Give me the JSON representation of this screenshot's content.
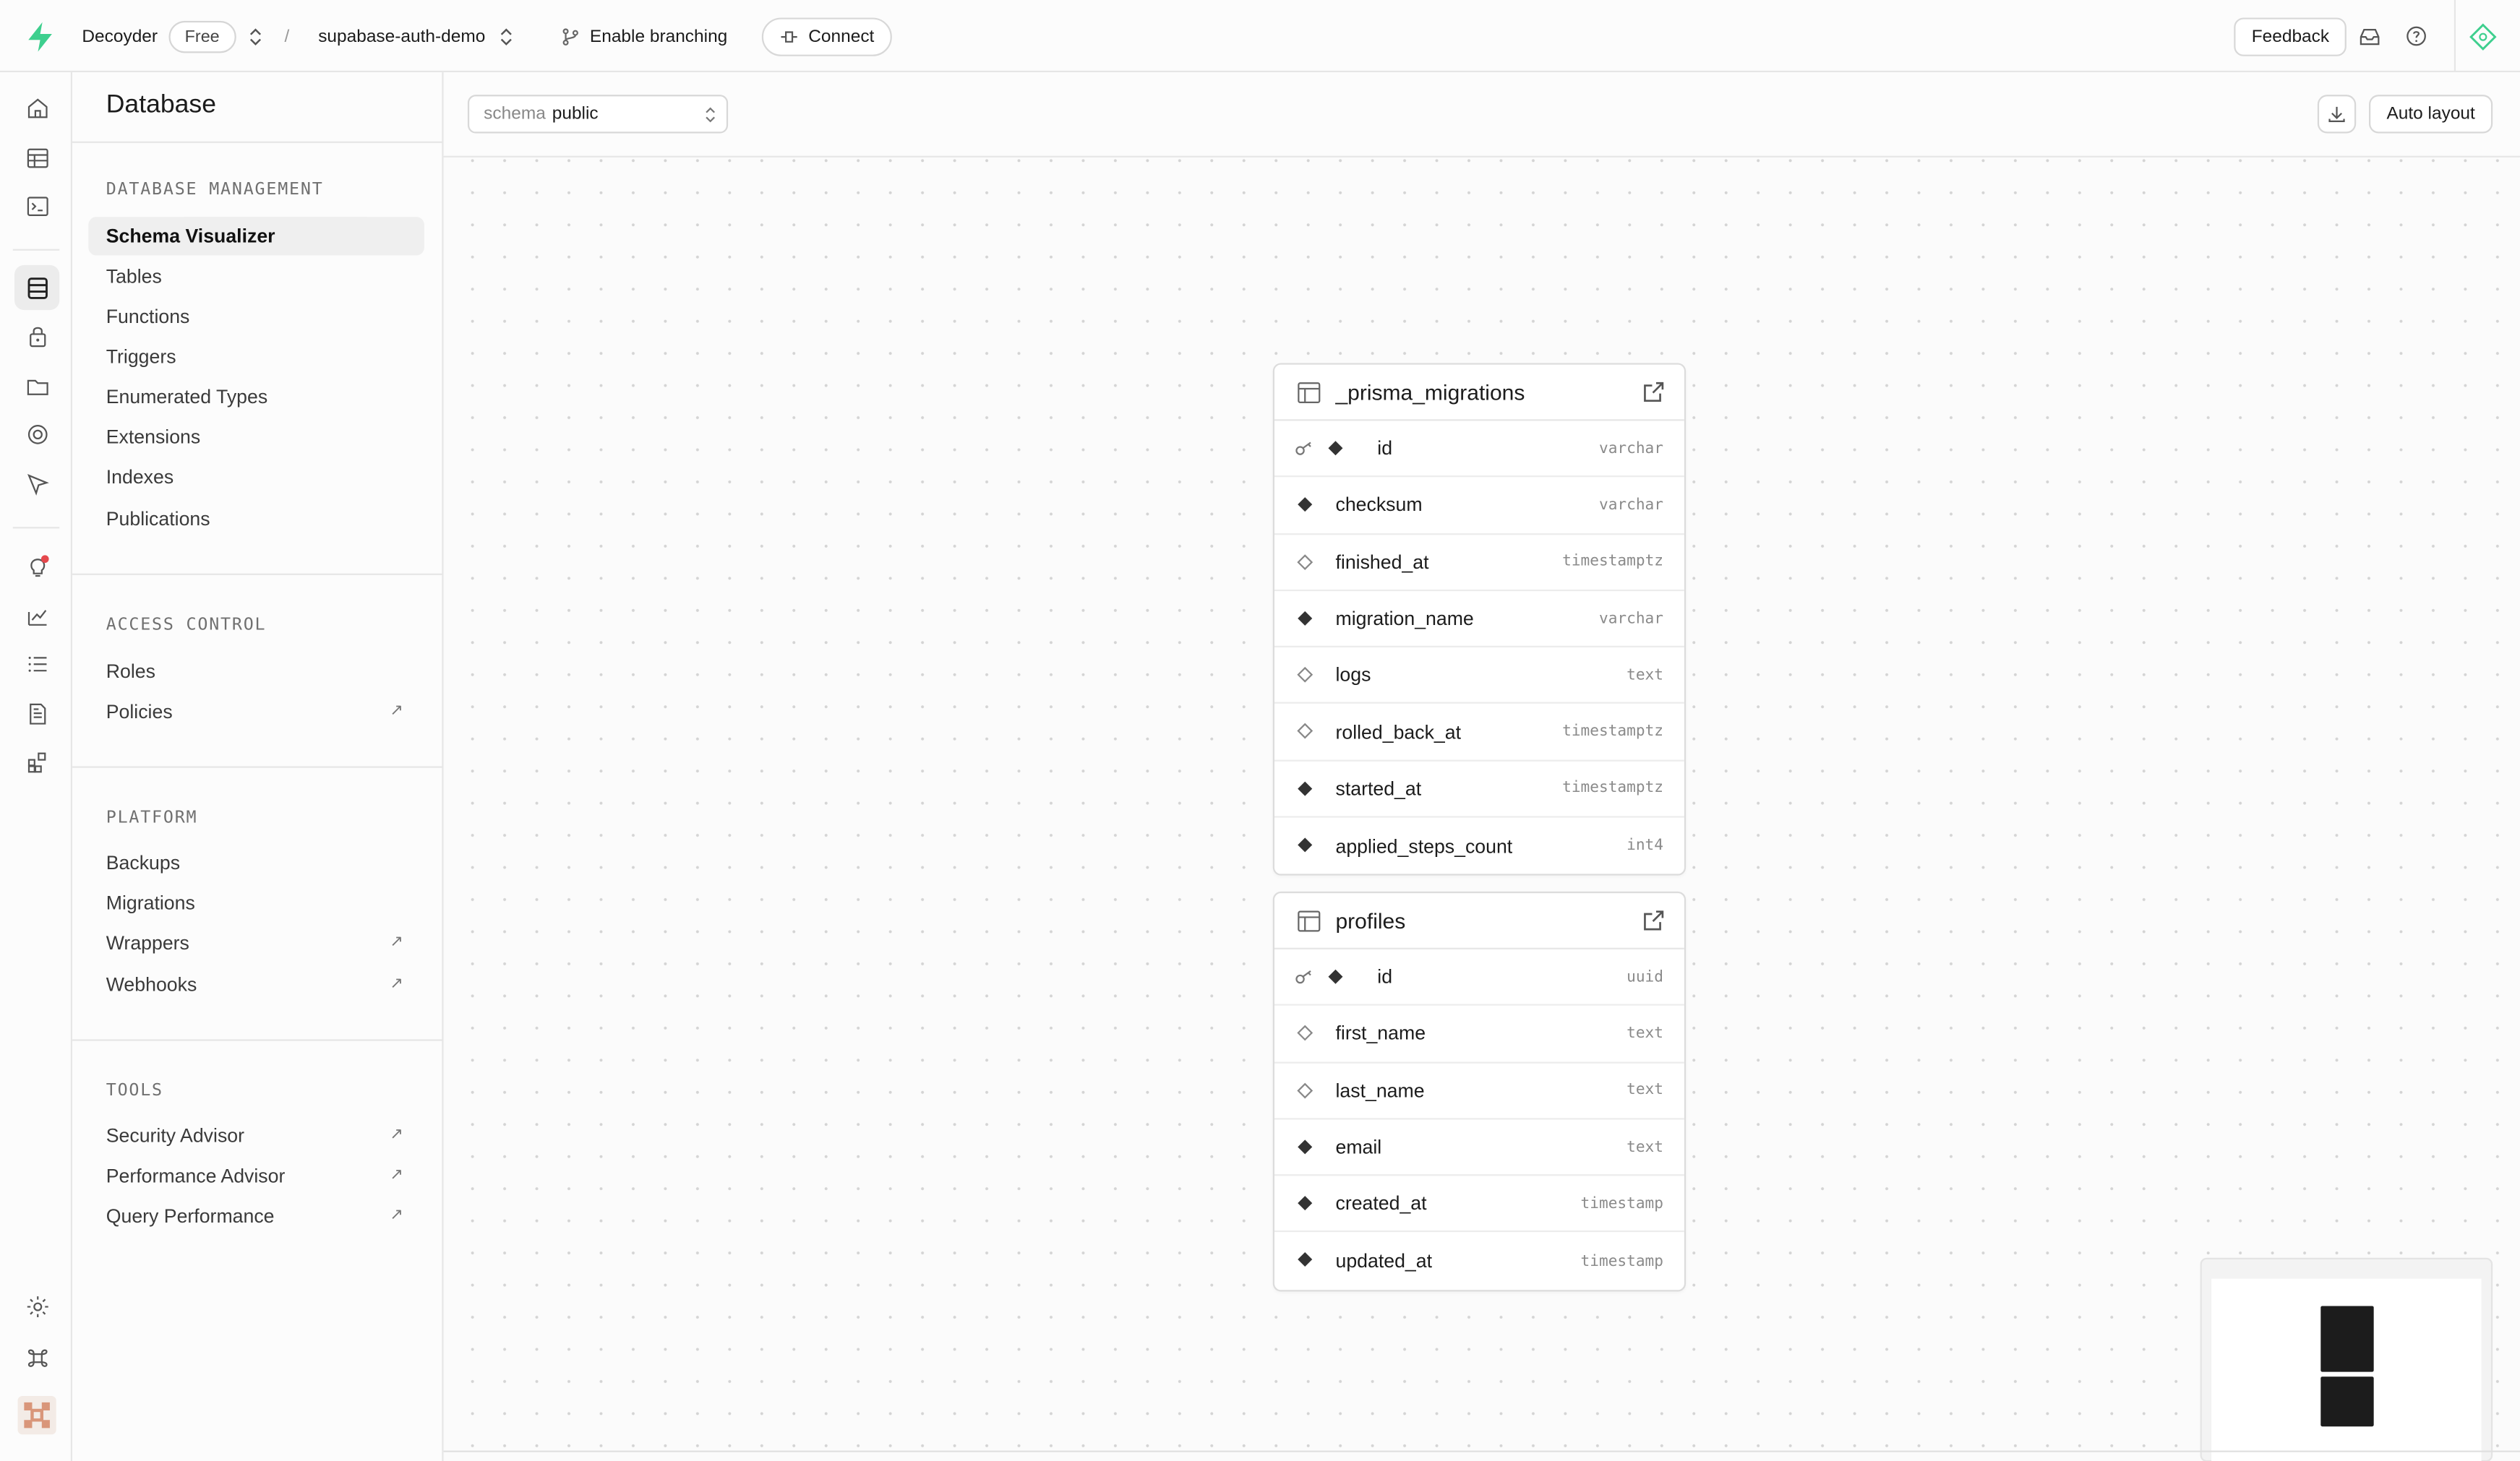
{
  "topbar": {
    "org_name": "Decoyder",
    "plan_badge": "Free",
    "separator": "/",
    "project_name": "supabase-auth-demo",
    "branching_label": "Enable branching",
    "connect_label": "Connect",
    "feedback_label": "Feedback"
  },
  "sidebar": {
    "title": "Database",
    "sections": [
      {
        "title": "DATABASE MANAGEMENT",
        "items": [
          {
            "label": "Schema Visualizer",
            "active": true
          },
          {
            "label": "Tables"
          },
          {
            "label": "Functions"
          },
          {
            "label": "Triggers"
          },
          {
            "label": "Enumerated Types"
          },
          {
            "label": "Extensions"
          },
          {
            "label": "Indexes"
          },
          {
            "label": "Publications"
          }
        ]
      },
      {
        "title": "ACCESS CONTROL",
        "items": [
          {
            "label": "Roles"
          },
          {
            "label": "Policies",
            "external": true
          }
        ]
      },
      {
        "title": "PLATFORM",
        "items": [
          {
            "label": "Backups"
          },
          {
            "label": "Migrations"
          },
          {
            "label": "Wrappers",
            "external": true
          },
          {
            "label": "Webhooks",
            "external": true
          }
        ]
      },
      {
        "title": "TOOLS",
        "items": [
          {
            "label": "Security Advisor",
            "external": true
          },
          {
            "label": "Performance Advisor",
            "external": true
          },
          {
            "label": "Query Performance",
            "external": true
          }
        ]
      }
    ]
  },
  "toolbar": {
    "schema_prefix": "schema",
    "schema_value": "public",
    "auto_layout_label": "Auto layout"
  },
  "tables": [
    {
      "name": "_prisma_migrations",
      "columns": [
        {
          "name": "id",
          "type": "varchar",
          "pk": true,
          "nullable": false
        },
        {
          "name": "checksum",
          "type": "varchar",
          "nullable": false
        },
        {
          "name": "finished_at",
          "type": "timestamptz",
          "nullable": true
        },
        {
          "name": "migration_name",
          "type": "varchar",
          "nullable": false
        },
        {
          "name": "logs",
          "type": "text",
          "nullable": true
        },
        {
          "name": "rolled_back_at",
          "type": "timestamptz",
          "nullable": true
        },
        {
          "name": "started_at",
          "type": "timestamptz",
          "nullable": false
        },
        {
          "name": "applied_steps_count",
          "type": "int4",
          "nullable": false
        }
      ]
    },
    {
      "name": "profiles",
      "columns": [
        {
          "name": "id",
          "type": "uuid",
          "pk": true,
          "nullable": false
        },
        {
          "name": "first_name",
          "type": "text",
          "nullable": true
        },
        {
          "name": "last_name",
          "type": "text",
          "nullable": true
        },
        {
          "name": "email",
          "type": "text",
          "nullable": false
        },
        {
          "name": "created_at",
          "type": "timestamp",
          "nullable": false
        },
        {
          "name": "updated_at",
          "type": "timestamp",
          "nullable": false
        }
      ]
    }
  ],
  "colors": {
    "brand": "#3ecf8e",
    "notification_dot": "#e5484d"
  }
}
